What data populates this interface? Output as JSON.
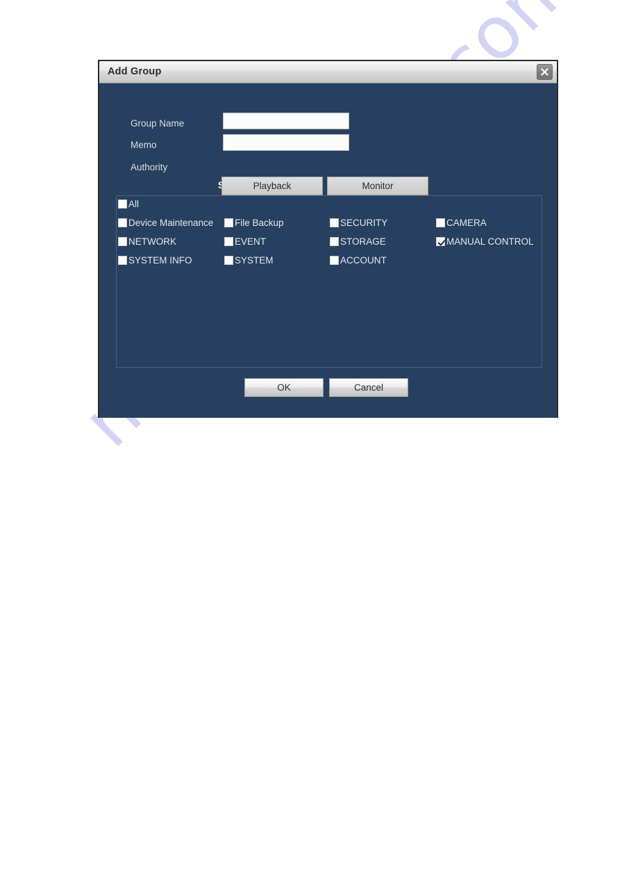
{
  "dialog": {
    "title": "Add Group",
    "close_icon": "close-icon",
    "fields": [
      {
        "label": "Group Name",
        "value": "",
        "placeholder": ""
      },
      {
        "label": "Memo",
        "value": "",
        "placeholder": ""
      }
    ],
    "authority_label": "Authority",
    "tabs": [
      {
        "label": "System",
        "active": true
      },
      {
        "label": "Playback",
        "active": false
      },
      {
        "label": "Monitor",
        "active": false
      }
    ],
    "permissions": {
      "select_all": {
        "label": "All",
        "checked": false
      },
      "columns": [
        [
          {
            "label": "Device Maintenance",
            "checked": false
          },
          {
            "label": "NETWORK",
            "checked": false
          },
          {
            "label": "SYSTEM INFO",
            "checked": false
          }
        ],
        [
          {
            "label": "File Backup",
            "checked": false
          },
          {
            "label": "EVENT",
            "checked": false
          },
          {
            "label": "SYSTEM",
            "checked": false
          }
        ],
        [
          {
            "label": "SECURITY",
            "checked": false
          },
          {
            "label": "STORAGE",
            "checked": false
          },
          {
            "label": "ACCOUNT",
            "checked": false
          }
        ],
        [
          {
            "label": "CAMERA",
            "checked": false
          },
          {
            "label": "MANUAL CONTROL",
            "checked": true
          }
        ]
      ]
    },
    "buttons": {
      "ok": "OK",
      "cancel": "Cancel"
    }
  },
  "watermark": {
    "text": "manualshive.com"
  },
  "colors": {
    "dialog_background": "#27405f",
    "titlebar_text": "#2e2e2e",
    "label_text": "#d7dde5",
    "input_background": "#fbfbfb",
    "button_face": "#dcdcdc",
    "watermark": "#5656d6"
  }
}
